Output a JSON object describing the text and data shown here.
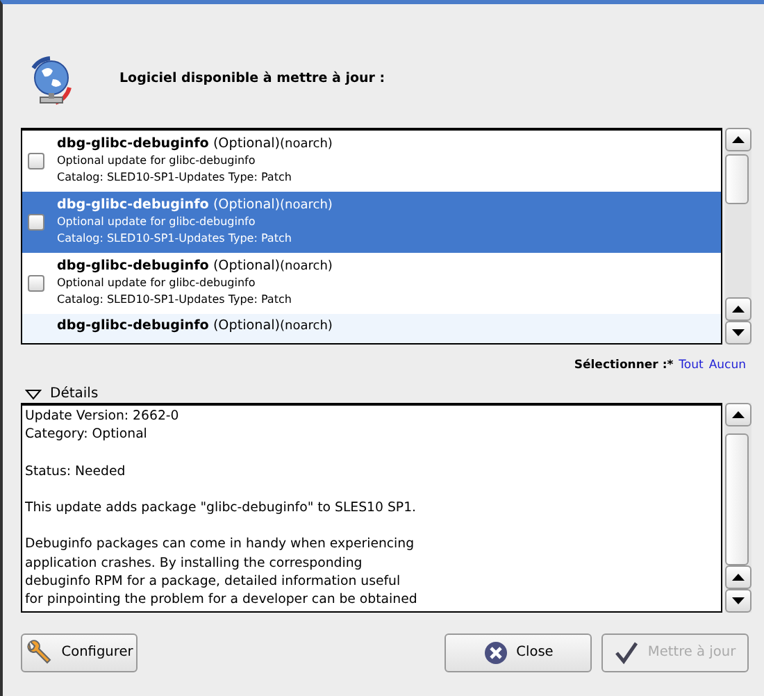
{
  "header": {
    "title": "Logiciel disponible à mettre à jour :"
  },
  "updates": [
    {
      "name": "dbg-glibc-debuginfo",
      "category": "(Optional)",
      "arch": "(noarch)",
      "summary": "Optional update for glibc-debuginfo",
      "catalog": "Catalog: SLED10-SP1-Updates Type: Patch",
      "checked": false,
      "selected": false
    },
    {
      "name": "dbg-glibc-debuginfo",
      "category": "(Optional)",
      "arch": "(noarch)",
      "summary": "Optional update for glibc-debuginfo",
      "catalog": "Catalog: SLED10-SP1-Updates Type: Patch",
      "checked": false,
      "selected": true
    },
    {
      "name": "dbg-glibc-debuginfo",
      "category": "(Optional)",
      "arch": "(noarch)",
      "summary": "Optional update for glibc-debuginfo",
      "catalog": "Catalog: SLED10-SP1-Updates Type: Patch",
      "checked": false,
      "selected": false
    },
    {
      "name": "dbg-glibc-debuginfo",
      "category": "(Optional)",
      "arch": "(noarch)",
      "selected": false
    }
  ],
  "select": {
    "label": "Sélectionner :*",
    "links": [
      "Tout",
      "Aucun"
    ]
  },
  "details": {
    "label": "Détails",
    "expanded": true,
    "paragraphs": [
      [
        "Update Version: 2662-0",
        "Category: Optional"
      ],
      [
        "Status: Needed"
      ],
      [
        "This update adds package \"glibc-debuginfo\" to SLES10 SP1."
      ],
      [
        "Debuginfo packages can come in handy when experiencing",
        "application crashes. By installing the corresponding",
        "debuginfo RPM for a package, detailed information useful",
        "for pinpointing the problem for a developer can be obtained"
      ]
    ]
  },
  "buttons": [
    {
      "kind": "configure",
      "label": "Configurer",
      "disabled": false
    },
    {
      "kind": "close",
      "label": "Close",
      "disabled": false
    },
    {
      "kind": "update",
      "label": "Mettre à jour",
      "disabled": true
    }
  ]
}
